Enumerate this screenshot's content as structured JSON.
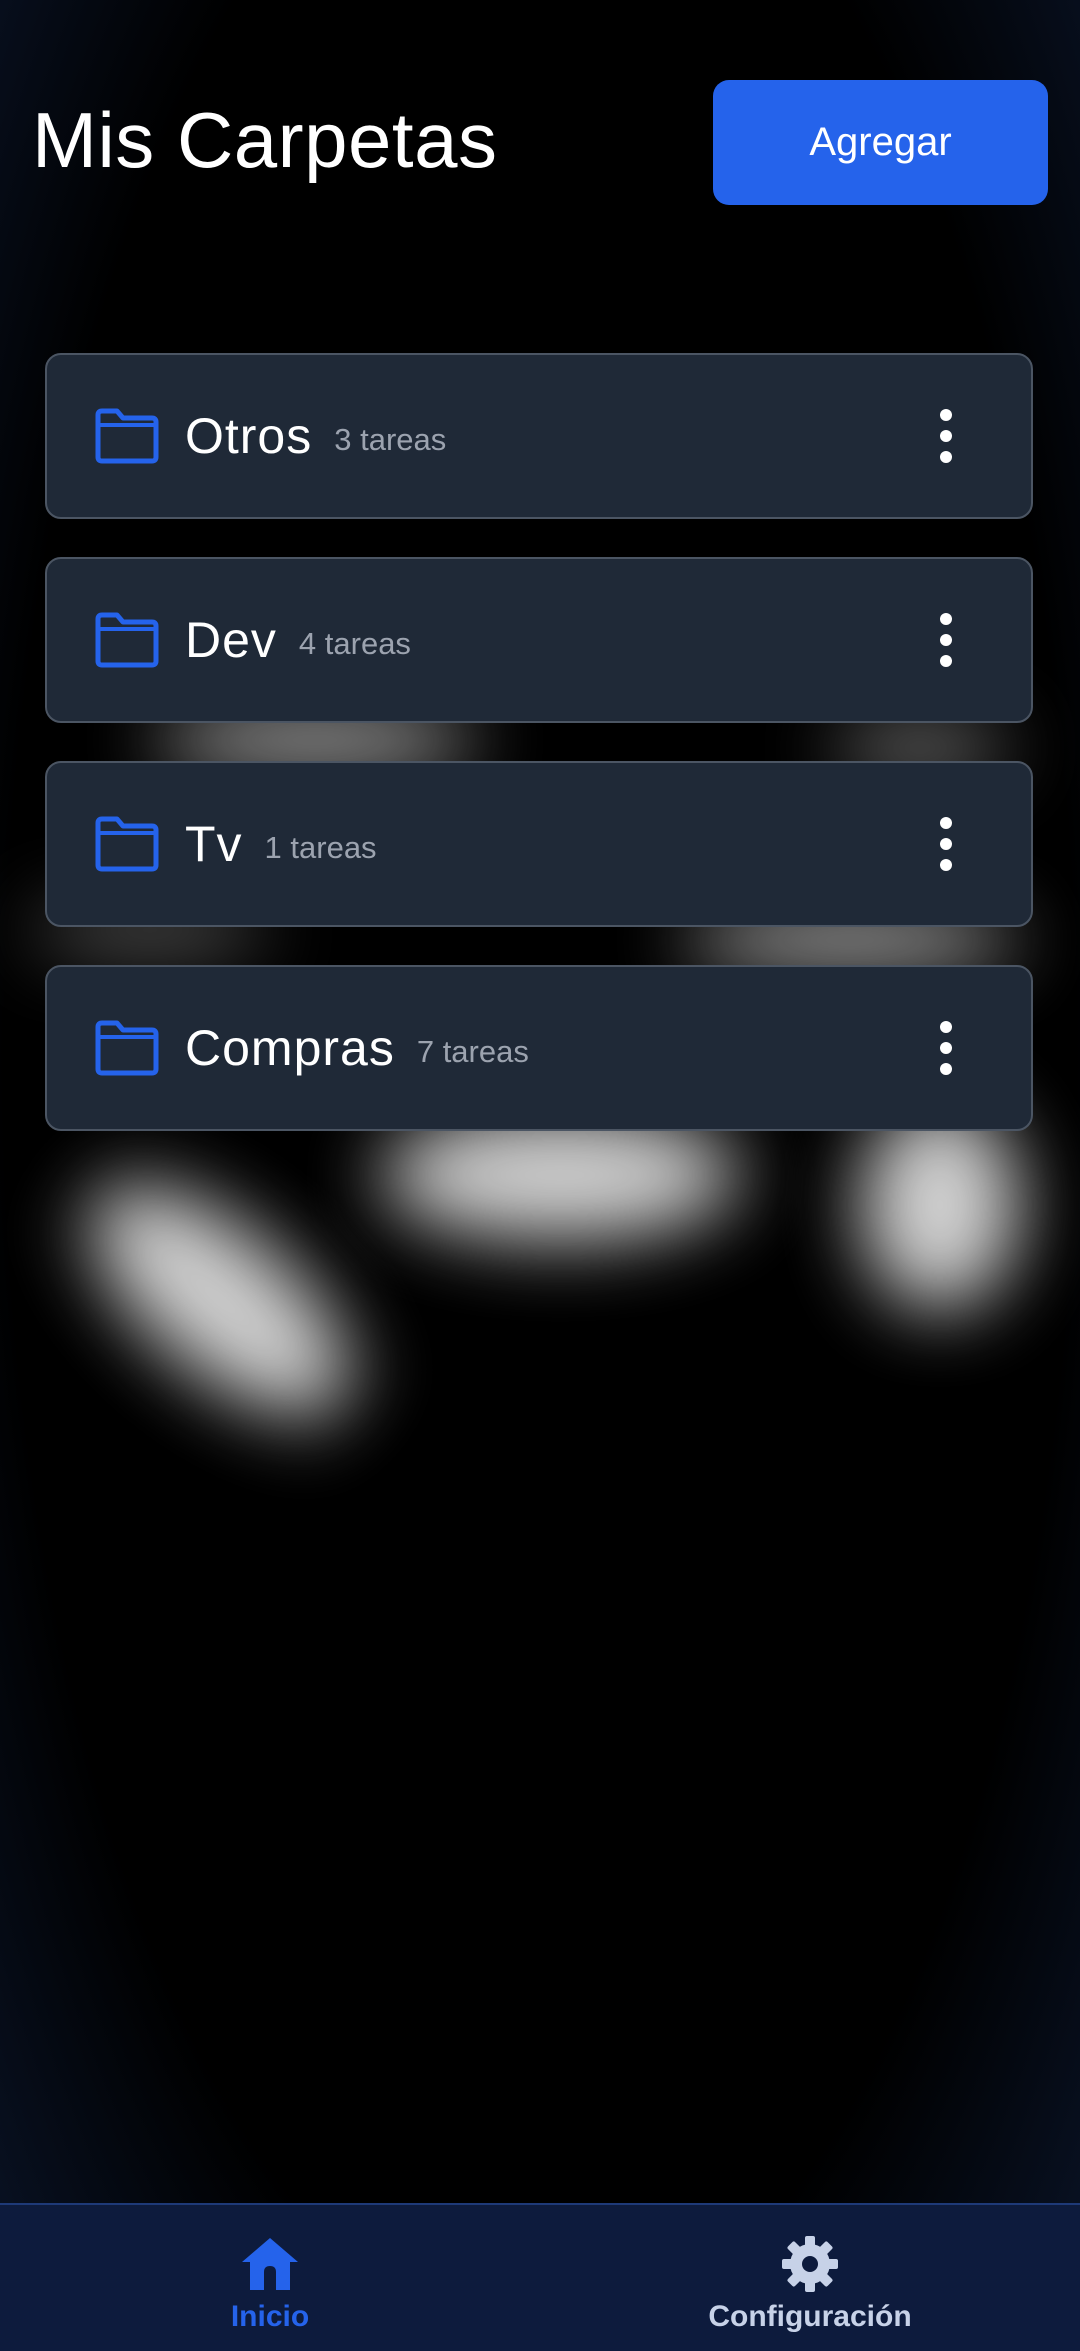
{
  "header": {
    "title": "Mis Carpetas",
    "add_label": "Agregar"
  },
  "folders": [
    {
      "name": "Otros",
      "count": "3 tareas"
    },
    {
      "name": "Dev",
      "count": "4 tareas"
    },
    {
      "name": "Tv",
      "count": "1 tareas"
    },
    {
      "name": "Compras",
      "count": "7 tareas"
    }
  ],
  "bottom_nav": {
    "items": [
      {
        "label": "Inicio",
        "icon": "home-icon",
        "active": true
      },
      {
        "label": "Configuración",
        "icon": "gear-icon",
        "active": false
      }
    ]
  },
  "colors": {
    "accent": "#2563eb",
    "nav_active": "#2563eb",
    "nav_inactive": "#c7d2e8",
    "card_bg": "#1f2937",
    "nav_bg": "#0d1b3d"
  }
}
